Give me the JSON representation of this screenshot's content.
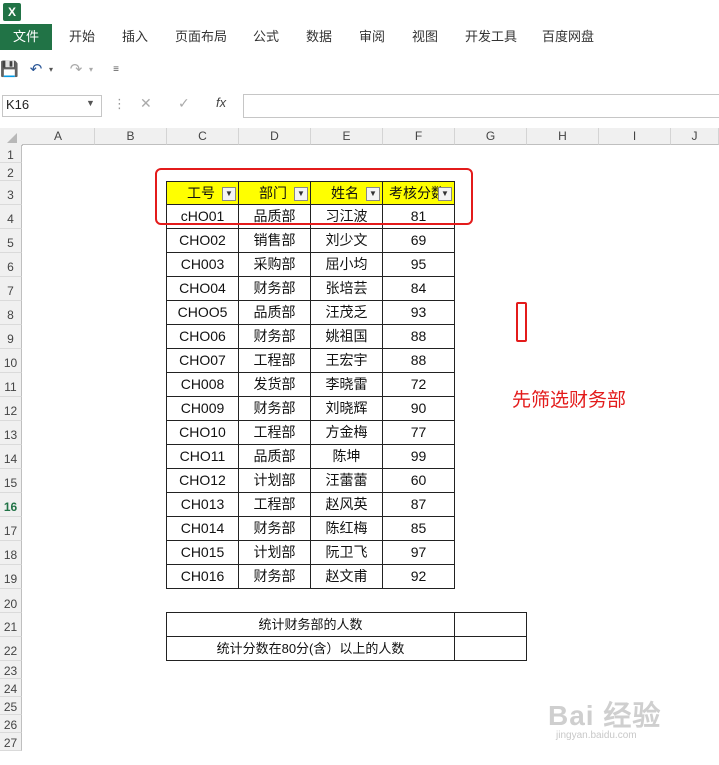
{
  "ribbon_tabs": [
    "文件",
    "开始",
    "插入",
    "页面布局",
    "公式",
    "数据",
    "审阅",
    "视图",
    "开发工具",
    "百度网盘"
  ],
  "name_box": "K16",
  "formula_bar": {
    "value": "",
    "fx_label": "fx"
  },
  "columns": [
    "A",
    "B",
    "C",
    "D",
    "E",
    "F",
    "G",
    "H",
    "I",
    "J"
  ],
  "rows": [
    "1",
    "2",
    "3",
    "4",
    "5",
    "6",
    "7",
    "8",
    "9",
    "10",
    "11",
    "12",
    "13",
    "14",
    "15",
    "16",
    "17",
    "18",
    "19",
    "20",
    "21",
    "22",
    "23",
    "24",
    "25",
    "26",
    "27"
  ],
  "active_row": "16",
  "table": {
    "headers": [
      "工号",
      "部门",
      "姓名",
      "考核分数"
    ],
    "header_color": "#ffff00",
    "rows": [
      [
        "cHO01",
        "品质部",
        "习江波",
        "81"
      ],
      [
        "CHO02",
        "销售部",
        "刘少文",
        "69"
      ],
      [
        "CH003",
        "采购部",
        "屈小均",
        "95"
      ],
      [
        "CHO04",
        "财务部",
        "张培芸",
        "84"
      ],
      [
        "CHOO5",
        "品质部",
        "汪茂乏",
        "93"
      ],
      [
        "CHO06",
        "财务部",
        "姚祖国",
        "88"
      ],
      [
        "CHO07",
        "工程部",
        "王宏宇",
        "88"
      ],
      [
        "CH008",
        "发货部",
        "李晓雷",
        "72"
      ],
      [
        "CH009",
        "财务部",
        "刘晓辉",
        "90"
      ],
      [
        "CHO10",
        "工程部",
        "方金梅",
        "77"
      ],
      [
        "CHO11",
        "品质部",
        "陈坤",
        "99"
      ],
      [
        "CHO12",
        "计划部",
        "汪蕾蕾",
        "60"
      ],
      [
        "CH013",
        "工程部",
        "赵风英",
        "87"
      ],
      [
        "CH014",
        "财务部",
        "陈红梅",
        "85"
      ],
      [
        "CH015",
        "计划部",
        "阮卫飞",
        "97"
      ],
      [
        "CH016",
        "财务部",
        "赵文甫",
        "92"
      ]
    ]
  },
  "summary": [
    {
      "label": "统计财务部的人数",
      "value": ""
    },
    {
      "label": "统计分数在80分(含）以上的人数",
      "value": ""
    }
  ],
  "annotation": "先筛选财务部",
  "accent_color": "#217346",
  "annotation_color": "#e31b1b",
  "watermark": {
    "main": "Bai 经验",
    "sub": "jingyan.baidu.com"
  }
}
